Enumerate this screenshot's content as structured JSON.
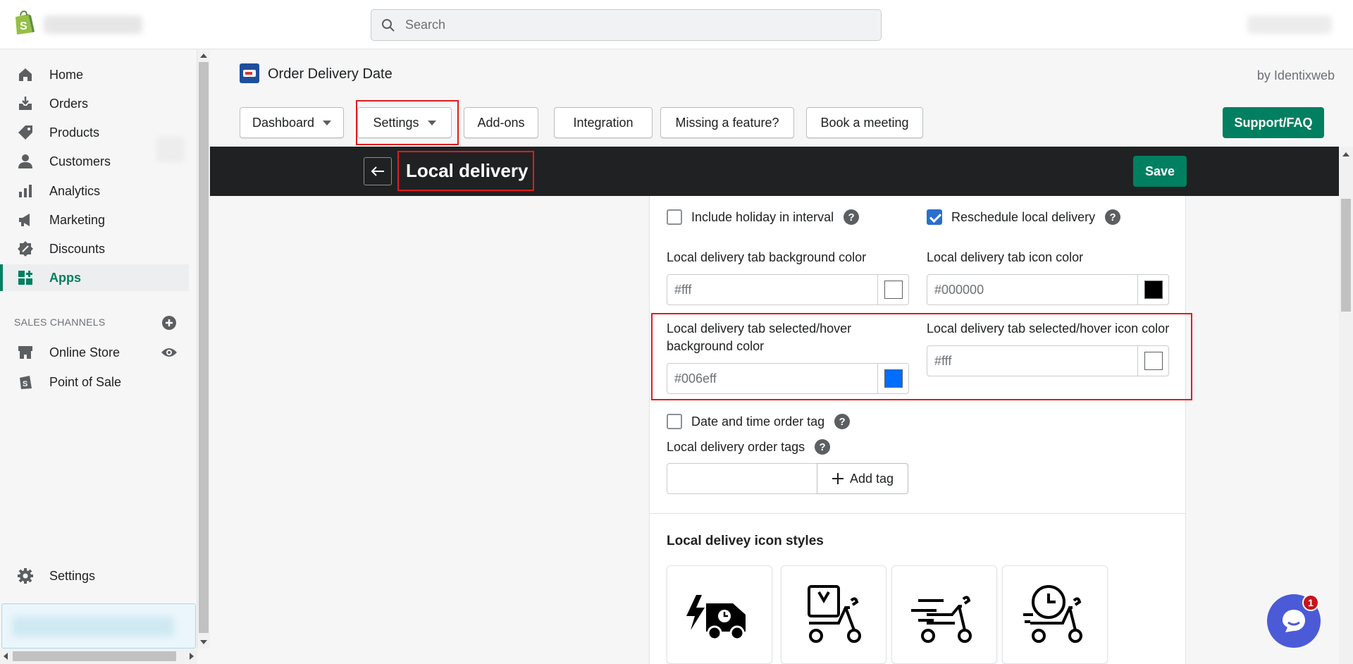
{
  "topbar": {
    "search_placeholder": "Search"
  },
  "sidebar": {
    "items": [
      {
        "label": "Home",
        "icon": "home-icon"
      },
      {
        "label": "Orders",
        "icon": "orders-icon"
      },
      {
        "label": "Products",
        "icon": "tag-icon"
      },
      {
        "label": "Customers",
        "icon": "person-icon"
      },
      {
        "label": "Analytics",
        "icon": "bar-chart-icon"
      },
      {
        "label": "Marketing",
        "icon": "megaphone-icon"
      },
      {
        "label": "Discounts",
        "icon": "discount-icon"
      },
      {
        "label": "Apps",
        "icon": "apps-icon",
        "active": true
      }
    ],
    "sales_channels_title": "SALES CHANNELS",
    "channels": [
      {
        "label": "Online Store",
        "icon": "store-icon"
      },
      {
        "label": "Point of Sale",
        "icon": "pos-icon"
      }
    ],
    "settings_label": "Settings"
  },
  "app": {
    "title": "Order Delivery Date",
    "by": "by Identixweb"
  },
  "tabs": {
    "dashboard": "Dashboard",
    "settings": "Settings",
    "addons": "Add-ons",
    "integration": "Integration",
    "missing": "Missing a feature?",
    "book": "Book a meeting",
    "support": "Support/FAQ"
  },
  "page": {
    "heading": "Local delivery",
    "save": "Save"
  },
  "form": {
    "include_holiday": {
      "label": "Include holiday in interval",
      "checked": false
    },
    "reschedule": {
      "label": "Reschedule local delivery",
      "checked": true
    },
    "tab_bg": {
      "label": "Local delivery tab background color",
      "value": "#fff",
      "swatch": "#ffffff"
    },
    "tab_icon": {
      "label": "Local delivery tab icon color",
      "value": "#000000",
      "swatch": "#000000"
    },
    "tab_sel_bg": {
      "label": "Local delivery tab selected/hover background color",
      "value": "#006eff",
      "swatch": "#006eff"
    },
    "tab_sel_icon": {
      "label": "Local delivery tab selected/hover icon color",
      "value": "#fff",
      "swatch": "#ffffff"
    },
    "date_tag": {
      "label": "Date and time order tag",
      "checked": false
    },
    "order_tags_label": "Local delivery order tags",
    "add_tag": "Add tag",
    "icon_styles_title": "Local delivey icon styles"
  },
  "chat": {
    "badge": "1"
  },
  "colors": {
    "accent": "#008060",
    "highlight": "#e21b1b",
    "dark": "#202123"
  }
}
